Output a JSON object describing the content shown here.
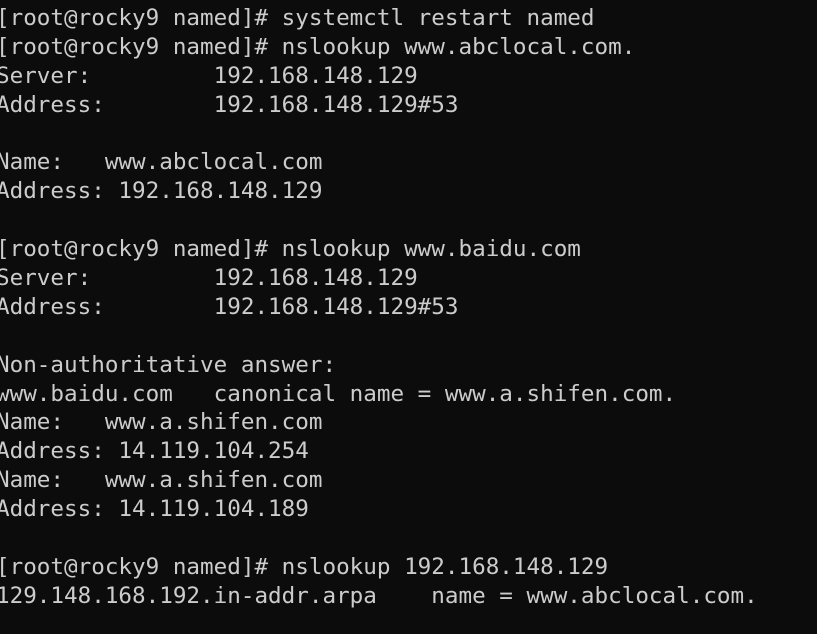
{
  "terminal": {
    "colors": {
      "background": "#0c0c0c",
      "foreground": "#cccccc"
    },
    "lines": [
      "[root@rocky9 named]# systemctl restart named",
      "[root@rocky9 named]# nslookup www.abclocal.com.",
      "Server:         192.168.148.129",
      "Address:        192.168.148.129#53",
      "",
      "Name:   www.abclocal.com",
      "Address: 192.168.148.129",
      "",
      "[root@rocky9 named]# nslookup www.baidu.com",
      "Server:         192.168.148.129",
      "Address:        192.168.148.129#53",
      "",
      "Non-authoritative answer:",
      "www.baidu.com   canonical name = www.a.shifen.com.",
      "Name:   www.a.shifen.com",
      "Address: 14.119.104.254",
      "Name:   www.a.shifen.com",
      "Address: 14.119.104.189",
      "",
      "[root@rocky9 named]# nslookup 192.168.148.129",
      "129.148.168.192.in-addr.arpa    name = www.abclocal.com."
    ]
  }
}
